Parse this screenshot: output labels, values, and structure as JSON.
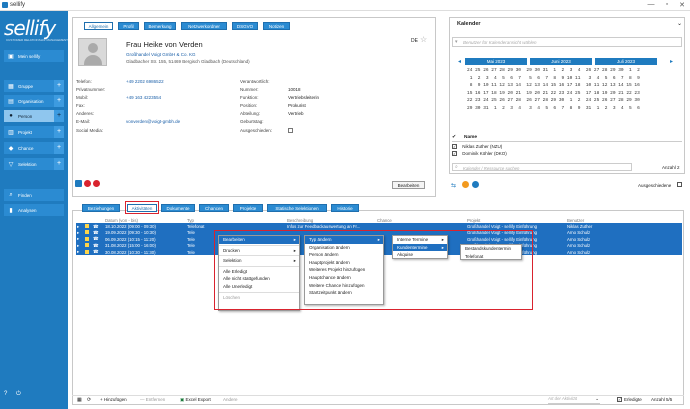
{
  "window": {
    "title": "sellify",
    "ctrl_min": "—",
    "ctrl_max": "▫",
    "ctrl_close": "✕"
  },
  "sidebar": {
    "logo": "sellify",
    "logo_sub": "CUSTOMER RELATIONSHIP MANAGEMENT",
    "items": [
      {
        "label": "Mein sellify",
        "plus": false
      },
      {
        "label": "Gruppe",
        "plus": true
      },
      {
        "label": "Organisation",
        "plus": true
      },
      {
        "label": "Person",
        "plus": true
      },
      {
        "label": "Projekt",
        "plus": true
      },
      {
        "label": "Chance",
        "plus": true
      },
      {
        "label": "Selektion",
        "plus": true
      },
      {
        "label": "Finden",
        "plus": false
      },
      {
        "label": "Analysen",
        "plus": false
      }
    ]
  },
  "person_tabs": [
    "Allgemein",
    "Profil",
    "Bemerkung",
    "Netzwerkordner",
    "DSGVO",
    "Notizen"
  ],
  "person": {
    "name": "Frau Heike von Verden",
    "company": "Großhandel Voigt GmbH & Co. KG",
    "address": "Gladbacher Str. 155, 51469 Bergisch Gladbach (Deutschland)",
    "lang": "DE",
    "left_labels": [
      "Telefon:",
      "Privatnummer:",
      "Mobil:",
      "Fax:",
      "Anderes:",
      "E-Mail:",
      "Social Media:"
    ],
    "left_values": [
      "+49 2202 6986522",
      "",
      "+49 163 4223554",
      "",
      "",
      "vonverden@voigt-gmbh.de",
      ""
    ],
    "right_labels": [
      "Verantwortlich:",
      "Nummer:",
      "Funktion:",
      "Position:",
      "Abteilung:",
      "Geburtstag:",
      "Ausgeschieden:"
    ],
    "right_values": [
      "",
      "10018",
      "Vertriebsleiterin",
      "Prokurist",
      "Vertrieb",
      "",
      ""
    ],
    "edit_button": "Bearbeiten"
  },
  "calendar": {
    "title": "Kalender",
    "search_placeholder": "Benutzer für Kalenderansicht wählen",
    "months": [
      "Mai 2023",
      "Juni 2023",
      "Juli 2023"
    ],
    "grid": [
      "24 25 26 27 28 29 30  29 30 31  1  2  3  4  26 27 28 29 30  1  2",
      " 1  2  3  4  5  6  7   5  6  7  8  9 10 11   3  4  5  6  7  8  9",
      " 8  9 10 11 12 13 14  12 13 14 15 16 17 18  10 11 12 13 14 15 16",
      "15 16 17 18 19 20 21  19 20 21 22 23 24 25  17 18 19 20 21 22 23",
      "22 23 24 25 26 27 28  26 27 28 29 30  1  2  24 25 26 27 28 29 30",
      "29 30 31  1  2  3  4   3  4  5  6  7  8  9  31  1  2  3  4  5  6"
    ],
    "name_header": "Name",
    "names": [
      "Niklas Zuther (NZU)",
      "Dominik Köhler (DKO)"
    ],
    "resource_placeholder": "Kalender / Ressource suchen",
    "count": "Anzahl 2",
    "ausgeschiedene": "Ausgeschiedene"
  },
  "bottom_tabs": [
    "Beziehungen",
    "Aktivitäten",
    "Dokumente",
    "Chancen",
    "Projekte",
    "Statische Selektionen",
    "Historie"
  ],
  "activities": {
    "headers": [
      "",
      "",
      "",
      "Datum (von - bis)",
      "Typ",
      "Beschreibung",
      "Chance",
      "Projekt",
      "Benutzer"
    ],
    "rows": [
      [
        "18.10.2022 (09:00 - 09:30)",
        "Telefonat",
        "Infos zur Feedbackauswertung an Fr...",
        "",
        "Großhandel Voigt - sellify Einführung",
        "Niklas Zuther"
      ],
      [
        "19.09.2022 (09:30 - 10:30)",
        "Tele",
        "",
        "",
        "Großhandel Voigt - sellify Einführung",
        "Arno Schulz"
      ],
      [
        "06.09.2022 (10:15 - 11:20)",
        "Tele",
        "",
        "",
        "Großhandel Voigt - sellify Einführung",
        "Arno Schulz"
      ],
      [
        "31.08.2022 (15:00 - 16:00)",
        "Tele",
        "",
        "",
        "Großhandel Voigt - sellify Einführung",
        "Arno Schulz"
      ],
      [
        "30.08.2022 (10:30 - 11:30)",
        "Tele",
        "",
        "",
        "Großhandel Voigt - sellify Einführung",
        "Arno Schulz"
      ]
    ]
  },
  "menu1": [
    "Bearbeiten",
    "Drucken",
    "Selektion",
    "Alle Erledigt",
    "Alle nicht stattgefunden",
    "Alle Unerledigt",
    "Löschen"
  ],
  "menu2": [
    "Typ ändern",
    "Organisation ändern",
    "Person ändern",
    "Hauptprojekt ändern",
    "Weiteres Projekt hinzufügen",
    "Hauptchance ändern",
    "Weitere Chance hinzufügen",
    "Startzeitpunkt ändern"
  ],
  "menu3": [
    "Interne Termine",
    "Kundentermine",
    "Akquise"
  ],
  "menu4": [
    "Bestandskundentermin",
    "Telefonat"
  ],
  "footer": {
    "add": "Hinzufügen",
    "remove": "Entfernen",
    "export": "Excel Export",
    "andere": "Andere",
    "art_placeholder": "Art der Aktivität",
    "erledigte": "Erledigte",
    "count": "Anzahl 5/5"
  }
}
